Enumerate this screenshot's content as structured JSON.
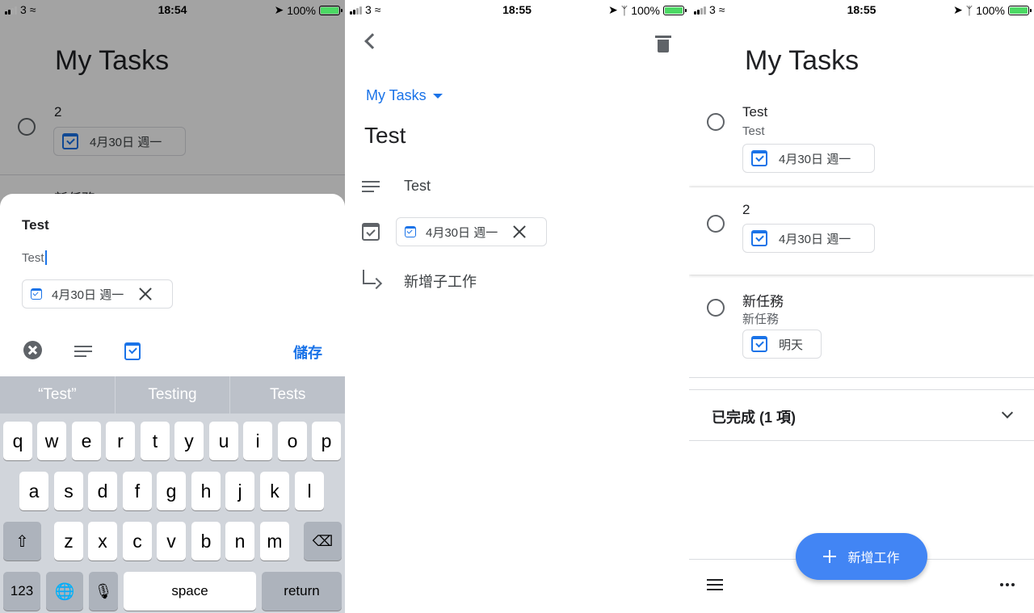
{
  "panel1": {
    "status": {
      "carrier": "3",
      "time": "18:54",
      "battery": "100%"
    },
    "list_title": "My Tasks",
    "bg_task": {
      "title": "2",
      "date": "4月30日 週一"
    },
    "bg_task_partial": "新任務",
    "sheet": {
      "title": "Test",
      "detail": "Test",
      "date": "4月30日 週一",
      "save_label": "儲存"
    },
    "keyboard": {
      "suggestions": [
        "“Test”",
        "Testing",
        "Tests"
      ],
      "row1": [
        "q",
        "w",
        "e",
        "r",
        "t",
        "y",
        "u",
        "i",
        "o",
        "p"
      ],
      "row2": [
        "a",
        "s",
        "d",
        "f",
        "g",
        "h",
        "j",
        "k",
        "l"
      ],
      "row3": [
        "z",
        "x",
        "c",
        "v",
        "b",
        "n",
        "m"
      ],
      "numbers_label": "123",
      "space_label": "space",
      "return_label": "return"
    }
  },
  "panel2": {
    "status": {
      "carrier": "3",
      "time": "18:55",
      "battery": "100%"
    },
    "list_name": "My Tasks",
    "task_title": "Test",
    "details": "Test",
    "date": "4月30日 週一",
    "add_subtask": "新增子工作"
  },
  "panel3": {
    "status": {
      "carrier": "3",
      "time": "18:55",
      "battery": "100%"
    },
    "list_title": "My Tasks",
    "tasks": [
      {
        "title": "Test",
        "sub": "Test",
        "date": "4月30日 週一"
      },
      {
        "title": "2",
        "date": "4月30日 週一"
      },
      {
        "title": "新任務",
        "sub": "新任務",
        "date": "明天"
      }
    ],
    "completed_label": "已完成 (1 項)",
    "fab_label": "新增工作"
  },
  "colors": {
    "accent": "#1a73e8",
    "fab": "#4285f4",
    "battery": "#4cd964"
  }
}
